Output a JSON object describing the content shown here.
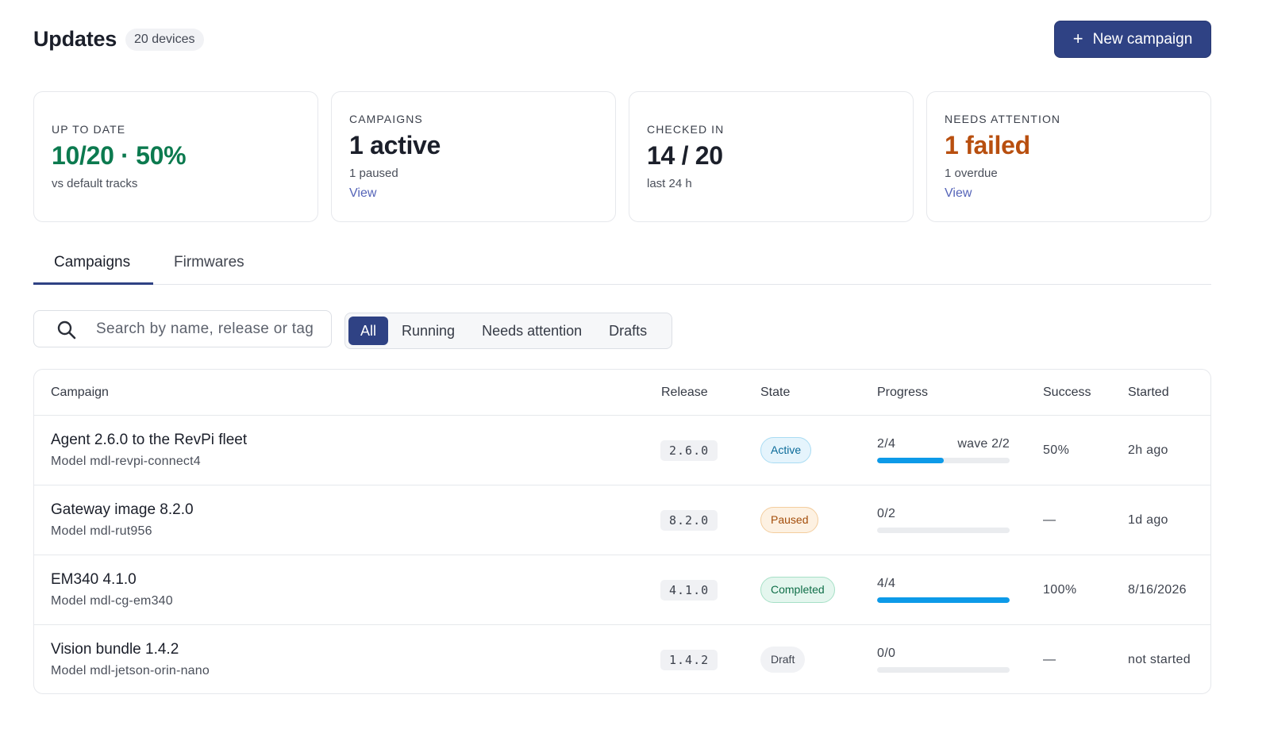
{
  "header": {
    "title": "Updates",
    "device_count": "20 devices",
    "new_campaign_icon": "+",
    "new_campaign_label": "New campaign"
  },
  "stats": [
    {
      "label": "UP TO DATE",
      "value": "10/20 · 50%",
      "sub": "vs default tracks",
      "link": ""
    },
    {
      "label": "CAMPAIGNS",
      "value": "1 active",
      "sub": "1 paused",
      "link": "View"
    },
    {
      "label": "CHECKED IN",
      "value": "14 / 20",
      "sub": "last 24 h",
      "link": ""
    },
    {
      "label": "NEEDS ATTENTION",
      "value": "1 failed",
      "sub": "1 overdue",
      "link": "View"
    }
  ],
  "tabs": [
    {
      "label": "Campaigns",
      "active": true
    },
    {
      "label": "Firmwares",
      "active": false
    }
  ],
  "search": {
    "placeholder": "Search by name, release or tag",
    "value": ""
  },
  "filters": [
    {
      "label": "All",
      "active": true
    },
    {
      "label": "Running",
      "active": false
    },
    {
      "label": "Needs attention",
      "active": false
    },
    {
      "label": "Drafts",
      "active": false
    }
  ],
  "table": {
    "columns": {
      "campaign": "Campaign",
      "release": "Release",
      "state": "State",
      "progress": "Progress",
      "success": "Success",
      "started": "Started"
    },
    "rows": [
      {
        "name": "Agent 2.6.0 to the RevPi fleet",
        "model": "Model mdl-revpi-connect4",
        "release": "2.6.0",
        "state": "Active",
        "progress_text": "2/4",
        "wave": "wave 2/2",
        "progress_fraction": 0.5,
        "success": "50%",
        "started": "2h ago"
      },
      {
        "name": "Gateway image 8.2.0",
        "model": "Model mdl-rut956",
        "release": "8.2.0",
        "state": "Paused",
        "progress_text": "0/2",
        "wave": "",
        "progress_fraction": 0,
        "success": "—",
        "started": "1d ago"
      },
      {
        "name": "EM340 4.1.0",
        "model": "Model mdl-cg-em340",
        "release": "4.1.0",
        "state": "Completed",
        "progress_text": "4/4",
        "wave": "",
        "progress_fraction": 1,
        "success": "100%",
        "started": "8/16/2026"
      },
      {
        "name": "Vision bundle 1.4.2",
        "model": "Model mdl-jetson-orin-nano",
        "release": "1.4.2",
        "state": "Draft",
        "progress_text": "0/0",
        "wave": "",
        "progress_fraction": 0,
        "success": "—",
        "started": "not started"
      }
    ]
  },
  "colors": {
    "primary": "#2f4284",
    "success_text": "#0c7a4f",
    "warning_text": "#b84f0f",
    "progress_fill": "#0d9ae8",
    "link": "#5564b8"
  }
}
